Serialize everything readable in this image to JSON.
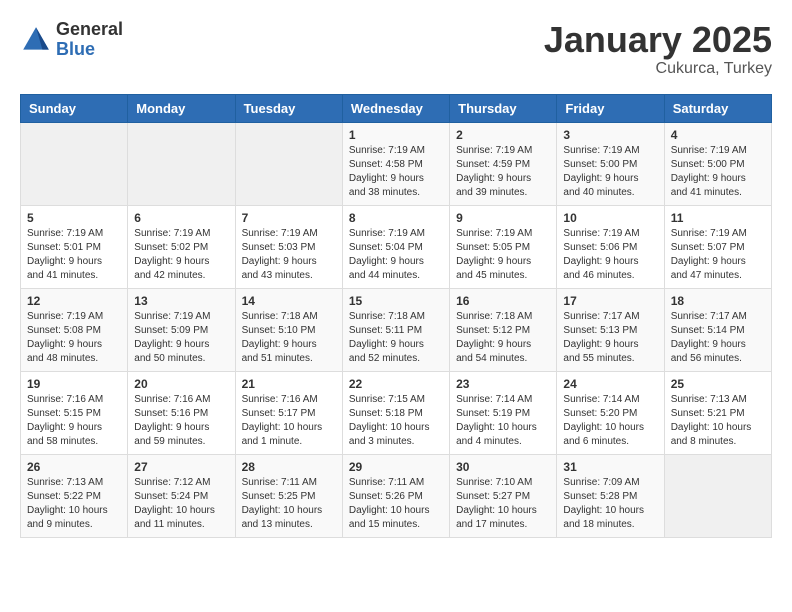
{
  "header": {
    "logo_general": "General",
    "logo_blue": "Blue",
    "month_title": "January 2025",
    "location": "Cukurca, Turkey"
  },
  "days_of_week": [
    "Sunday",
    "Monday",
    "Tuesday",
    "Wednesday",
    "Thursday",
    "Friday",
    "Saturday"
  ],
  "weeks": [
    [
      {
        "day": "",
        "info": ""
      },
      {
        "day": "",
        "info": ""
      },
      {
        "day": "",
        "info": ""
      },
      {
        "day": "1",
        "info": "Sunrise: 7:19 AM\nSunset: 4:58 PM\nDaylight: 9 hours\nand 38 minutes."
      },
      {
        "day": "2",
        "info": "Sunrise: 7:19 AM\nSunset: 4:59 PM\nDaylight: 9 hours\nand 39 minutes."
      },
      {
        "day": "3",
        "info": "Sunrise: 7:19 AM\nSunset: 5:00 PM\nDaylight: 9 hours\nand 40 minutes."
      },
      {
        "day": "4",
        "info": "Sunrise: 7:19 AM\nSunset: 5:00 PM\nDaylight: 9 hours\nand 41 minutes."
      }
    ],
    [
      {
        "day": "5",
        "info": "Sunrise: 7:19 AM\nSunset: 5:01 PM\nDaylight: 9 hours\nand 41 minutes."
      },
      {
        "day": "6",
        "info": "Sunrise: 7:19 AM\nSunset: 5:02 PM\nDaylight: 9 hours\nand 42 minutes."
      },
      {
        "day": "7",
        "info": "Sunrise: 7:19 AM\nSunset: 5:03 PM\nDaylight: 9 hours\nand 43 minutes."
      },
      {
        "day": "8",
        "info": "Sunrise: 7:19 AM\nSunset: 5:04 PM\nDaylight: 9 hours\nand 44 minutes."
      },
      {
        "day": "9",
        "info": "Sunrise: 7:19 AM\nSunset: 5:05 PM\nDaylight: 9 hours\nand 45 minutes."
      },
      {
        "day": "10",
        "info": "Sunrise: 7:19 AM\nSunset: 5:06 PM\nDaylight: 9 hours\nand 46 minutes."
      },
      {
        "day": "11",
        "info": "Sunrise: 7:19 AM\nSunset: 5:07 PM\nDaylight: 9 hours\nand 47 minutes."
      }
    ],
    [
      {
        "day": "12",
        "info": "Sunrise: 7:19 AM\nSunset: 5:08 PM\nDaylight: 9 hours\nand 48 minutes."
      },
      {
        "day": "13",
        "info": "Sunrise: 7:19 AM\nSunset: 5:09 PM\nDaylight: 9 hours\nand 50 minutes."
      },
      {
        "day": "14",
        "info": "Sunrise: 7:18 AM\nSunset: 5:10 PM\nDaylight: 9 hours\nand 51 minutes."
      },
      {
        "day": "15",
        "info": "Sunrise: 7:18 AM\nSunset: 5:11 PM\nDaylight: 9 hours\nand 52 minutes."
      },
      {
        "day": "16",
        "info": "Sunrise: 7:18 AM\nSunset: 5:12 PM\nDaylight: 9 hours\nand 54 minutes."
      },
      {
        "day": "17",
        "info": "Sunrise: 7:17 AM\nSunset: 5:13 PM\nDaylight: 9 hours\nand 55 minutes."
      },
      {
        "day": "18",
        "info": "Sunrise: 7:17 AM\nSunset: 5:14 PM\nDaylight: 9 hours\nand 56 minutes."
      }
    ],
    [
      {
        "day": "19",
        "info": "Sunrise: 7:16 AM\nSunset: 5:15 PM\nDaylight: 9 hours\nand 58 minutes."
      },
      {
        "day": "20",
        "info": "Sunrise: 7:16 AM\nSunset: 5:16 PM\nDaylight: 9 hours\nand 59 minutes."
      },
      {
        "day": "21",
        "info": "Sunrise: 7:16 AM\nSunset: 5:17 PM\nDaylight: 10 hours\nand 1 minute."
      },
      {
        "day": "22",
        "info": "Sunrise: 7:15 AM\nSunset: 5:18 PM\nDaylight: 10 hours\nand 3 minutes."
      },
      {
        "day": "23",
        "info": "Sunrise: 7:14 AM\nSunset: 5:19 PM\nDaylight: 10 hours\nand 4 minutes."
      },
      {
        "day": "24",
        "info": "Sunrise: 7:14 AM\nSunset: 5:20 PM\nDaylight: 10 hours\nand 6 minutes."
      },
      {
        "day": "25",
        "info": "Sunrise: 7:13 AM\nSunset: 5:21 PM\nDaylight: 10 hours\nand 8 minutes."
      }
    ],
    [
      {
        "day": "26",
        "info": "Sunrise: 7:13 AM\nSunset: 5:22 PM\nDaylight: 10 hours\nand 9 minutes."
      },
      {
        "day": "27",
        "info": "Sunrise: 7:12 AM\nSunset: 5:24 PM\nDaylight: 10 hours\nand 11 minutes."
      },
      {
        "day": "28",
        "info": "Sunrise: 7:11 AM\nSunset: 5:25 PM\nDaylight: 10 hours\nand 13 minutes."
      },
      {
        "day": "29",
        "info": "Sunrise: 7:11 AM\nSunset: 5:26 PM\nDaylight: 10 hours\nand 15 minutes."
      },
      {
        "day": "30",
        "info": "Sunrise: 7:10 AM\nSunset: 5:27 PM\nDaylight: 10 hours\nand 17 minutes."
      },
      {
        "day": "31",
        "info": "Sunrise: 7:09 AM\nSunset: 5:28 PM\nDaylight: 10 hours\nand 18 minutes."
      },
      {
        "day": "",
        "info": ""
      }
    ]
  ]
}
